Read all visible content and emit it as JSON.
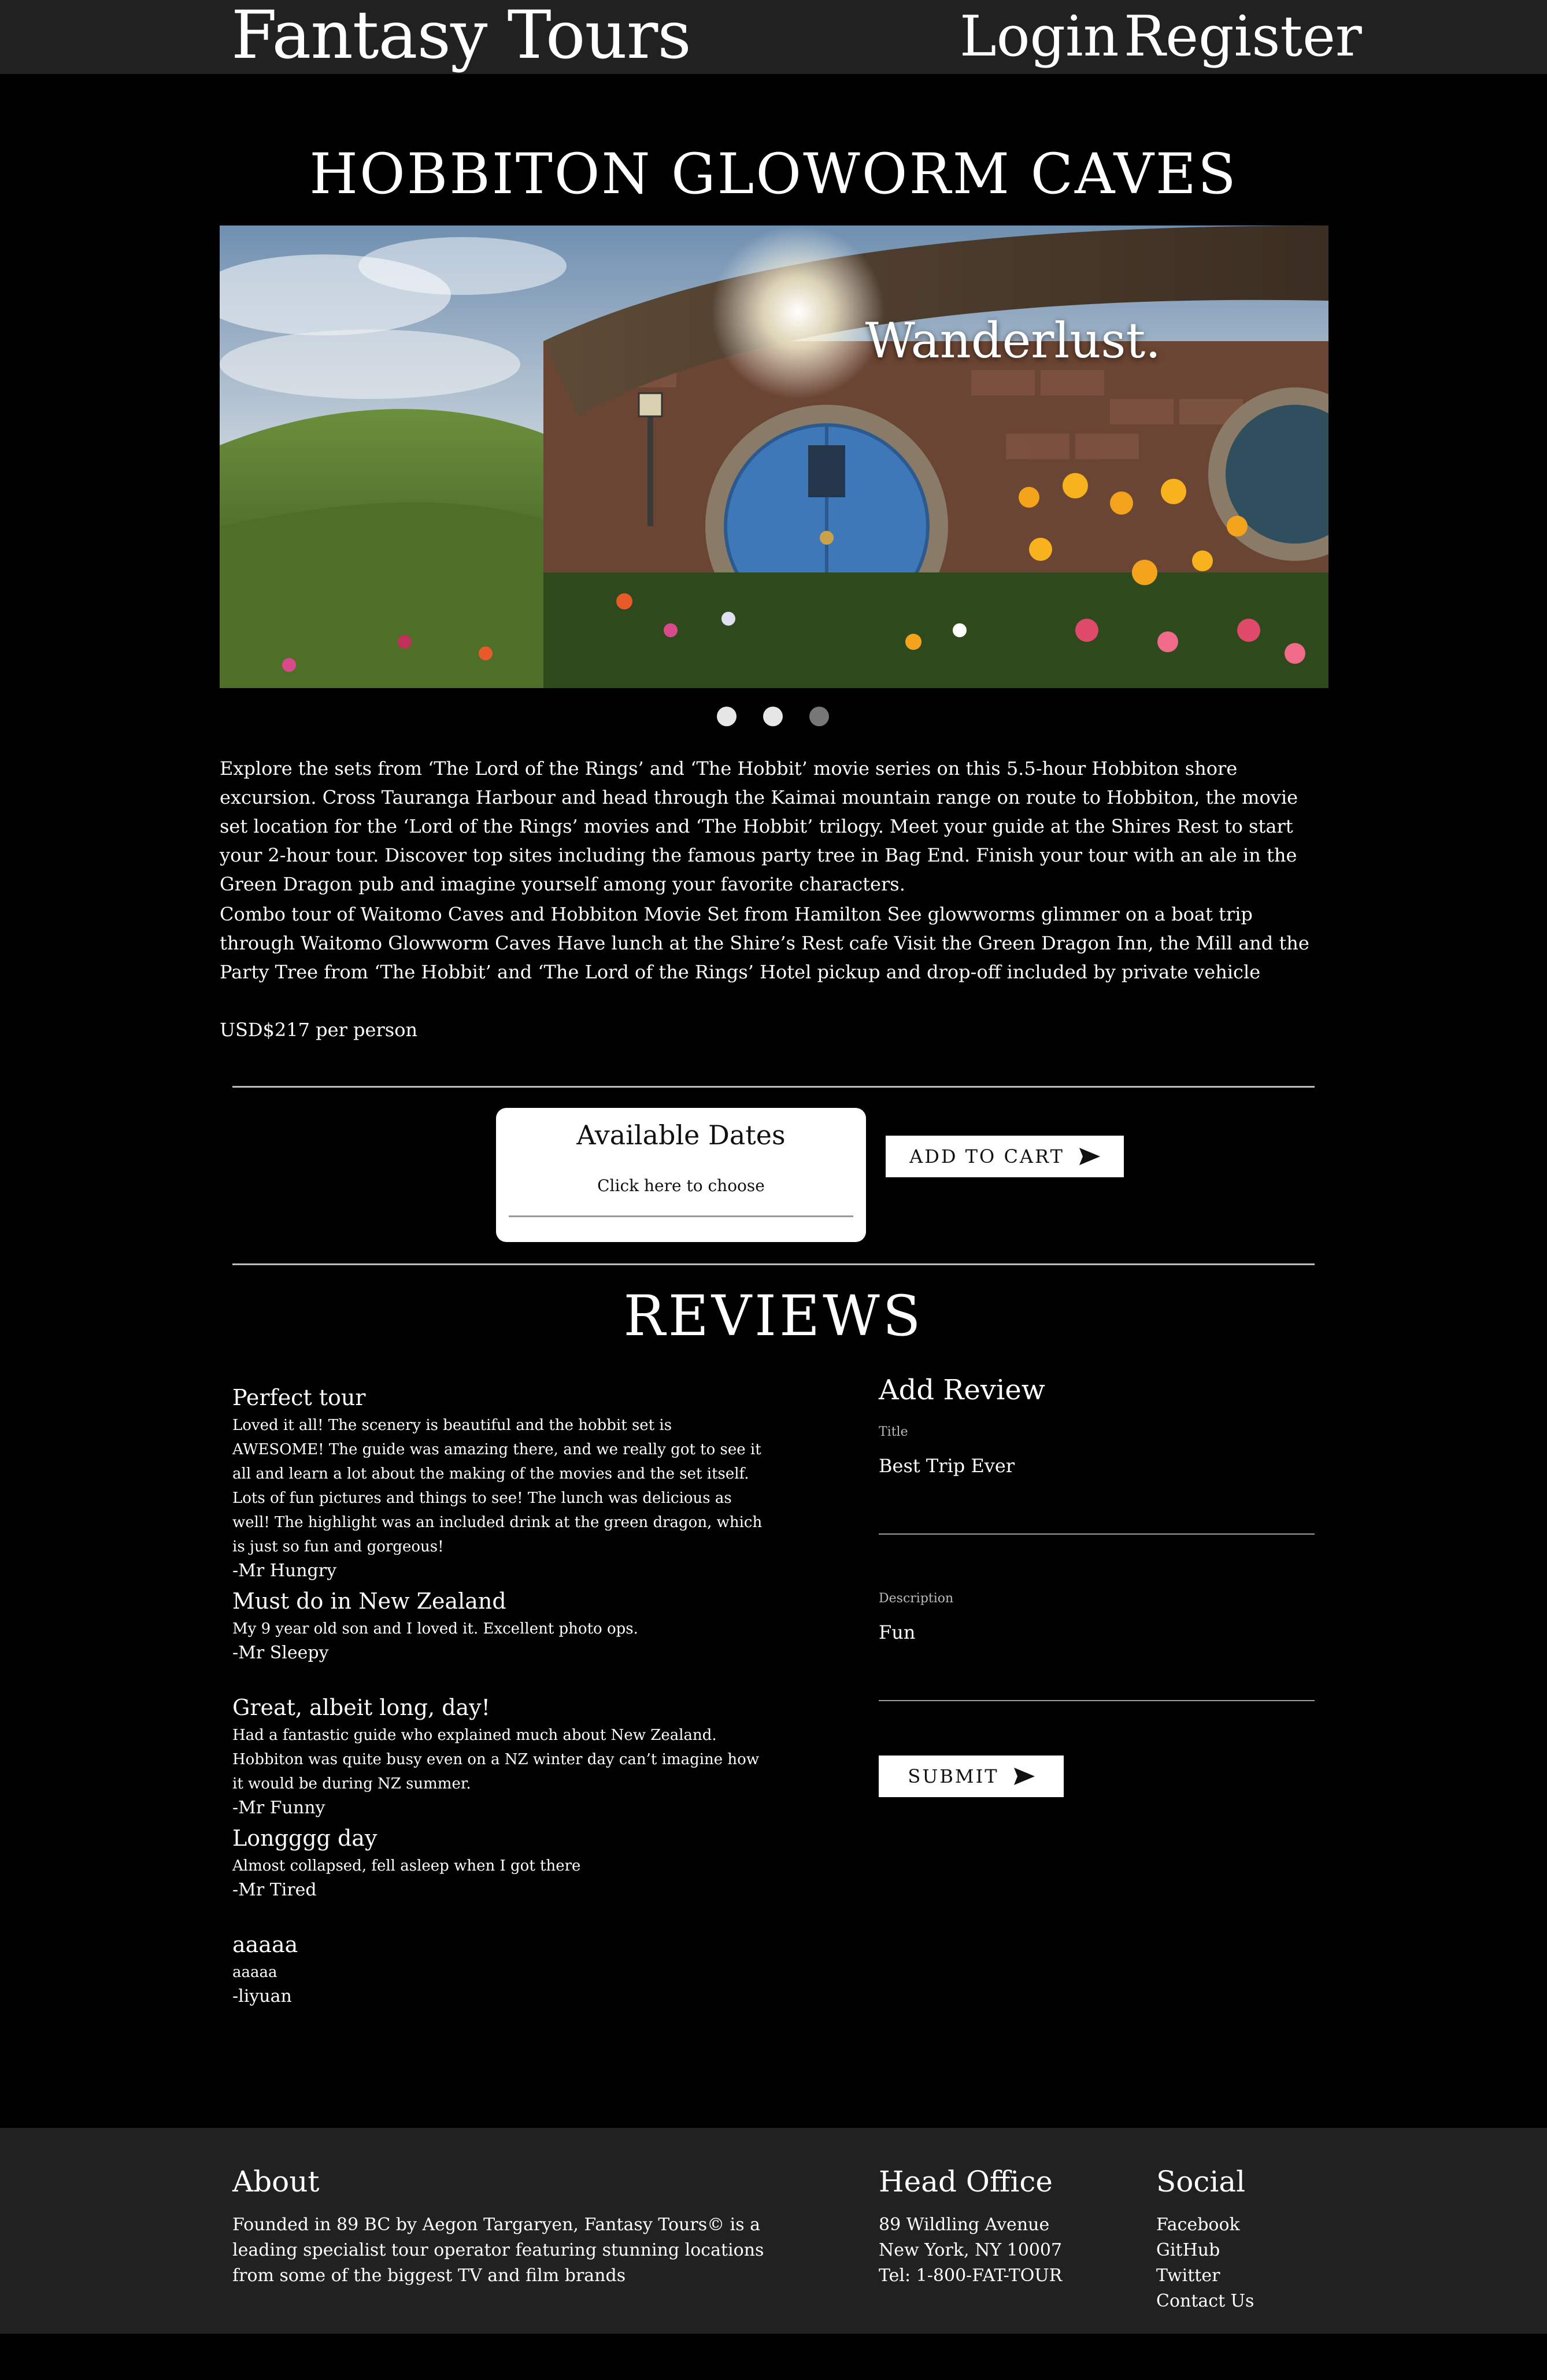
{
  "nav": {
    "brand": "Fantasy Tours",
    "login": "Login",
    "register": "Register"
  },
  "tour": {
    "title": "HOBBITON GLOWORM CAVES",
    "carousel_caption": "Wanderlust.",
    "carousel_slides": 3,
    "active_slide": 3,
    "description_1": "Explore the sets from ‘The Lord of the Rings’ and ‘The Hobbit’ movie series on this 5.5-hour Hobbiton shore excursion. Cross Tauranga Harbour and head through the Kaimai mountain range on route to Hobbiton, the movie set location for the ‘Lord of the Rings’ movies and ‘The Hobbit’ trilogy. Meet your guide at the Shires Rest to start your 2-hour tour. Discover top sites including the famous party tree in Bag End. Finish your tour with an ale in the Green Dragon pub and imagine yourself among your favorite characters.",
    "description_2": "Combo tour of Waitomo Caves and Hobbiton Movie Set from Hamilton See glowworms glimmer on a boat trip through Waitomo Glowworm Caves Have lunch at the Shire’s Rest cafe Visit the Green Dragon Inn, the Mill and the Party Tree from ‘The Hobbit’ and ‘The Lord of the Rings’ Hotel pickup and drop-off included by private vehicle",
    "price": "USD$217 per person"
  },
  "booking": {
    "dates_title": "Available Dates",
    "dates_hint": "Click here to choose",
    "add_to_cart": "ADD TO CART",
    "button_icon": "send-icon"
  },
  "reviews": {
    "heading": "REVIEWS",
    "items": [
      {
        "title": "Perfect tour",
        "body": "Loved it all! The scenery is beautiful and the hobbit set is AWESOME! The guide was amazing there, and we really got to see it all and learn a lot about the making of the movies and the set itself. Lots of fun pictures and things to see! The lunch was delicious as well! The highlight was an included drink at the green dragon, which is just so fun and gorgeous!",
        "author": "-Mr Hungry"
      },
      {
        "title": "Must do in New Zealand",
        "body": "My 9 year old son and I loved it. Excellent photo ops.",
        "author": "-Mr Sleepy"
      },
      {
        "title": "Great, albeit long, day!",
        "body": "Had a fantastic guide who explained much about New Zealand. Hobbiton was quite busy even on a NZ winter day can’t imagine how it would be during NZ summer.",
        "author": "-Mr Funny"
      },
      {
        "title": "Longggg day",
        "body": "Almost collapsed, fell asleep when I got there",
        "author": "-Mr Tired"
      },
      {
        "title": "aaaaa",
        "body": "aaaaa",
        "author": "-liyuan"
      }
    ]
  },
  "add_review": {
    "heading": "Add Review",
    "title_label": "Title",
    "title_value": "Best Trip Ever",
    "description_label": "Description",
    "description_value": "Fun",
    "submit": "SUBMIT"
  },
  "footer": {
    "about_heading": "About",
    "about_text": "Founded in 89 BC by Aegon Targaryen, Fantasy Tours© is a leading specialist tour operator featuring stunning locations from some of the biggest TV and film brands",
    "office_heading": "Head Office",
    "office_lines": [
      "89 Wildling Avenue",
      "New York, NY 10007",
      "Tel: 1-800-FAT-TOUR"
    ],
    "social_heading": "Social",
    "social_links": [
      "Facebook",
      "GitHub",
      "Twitter",
      "Contact Us"
    ]
  }
}
